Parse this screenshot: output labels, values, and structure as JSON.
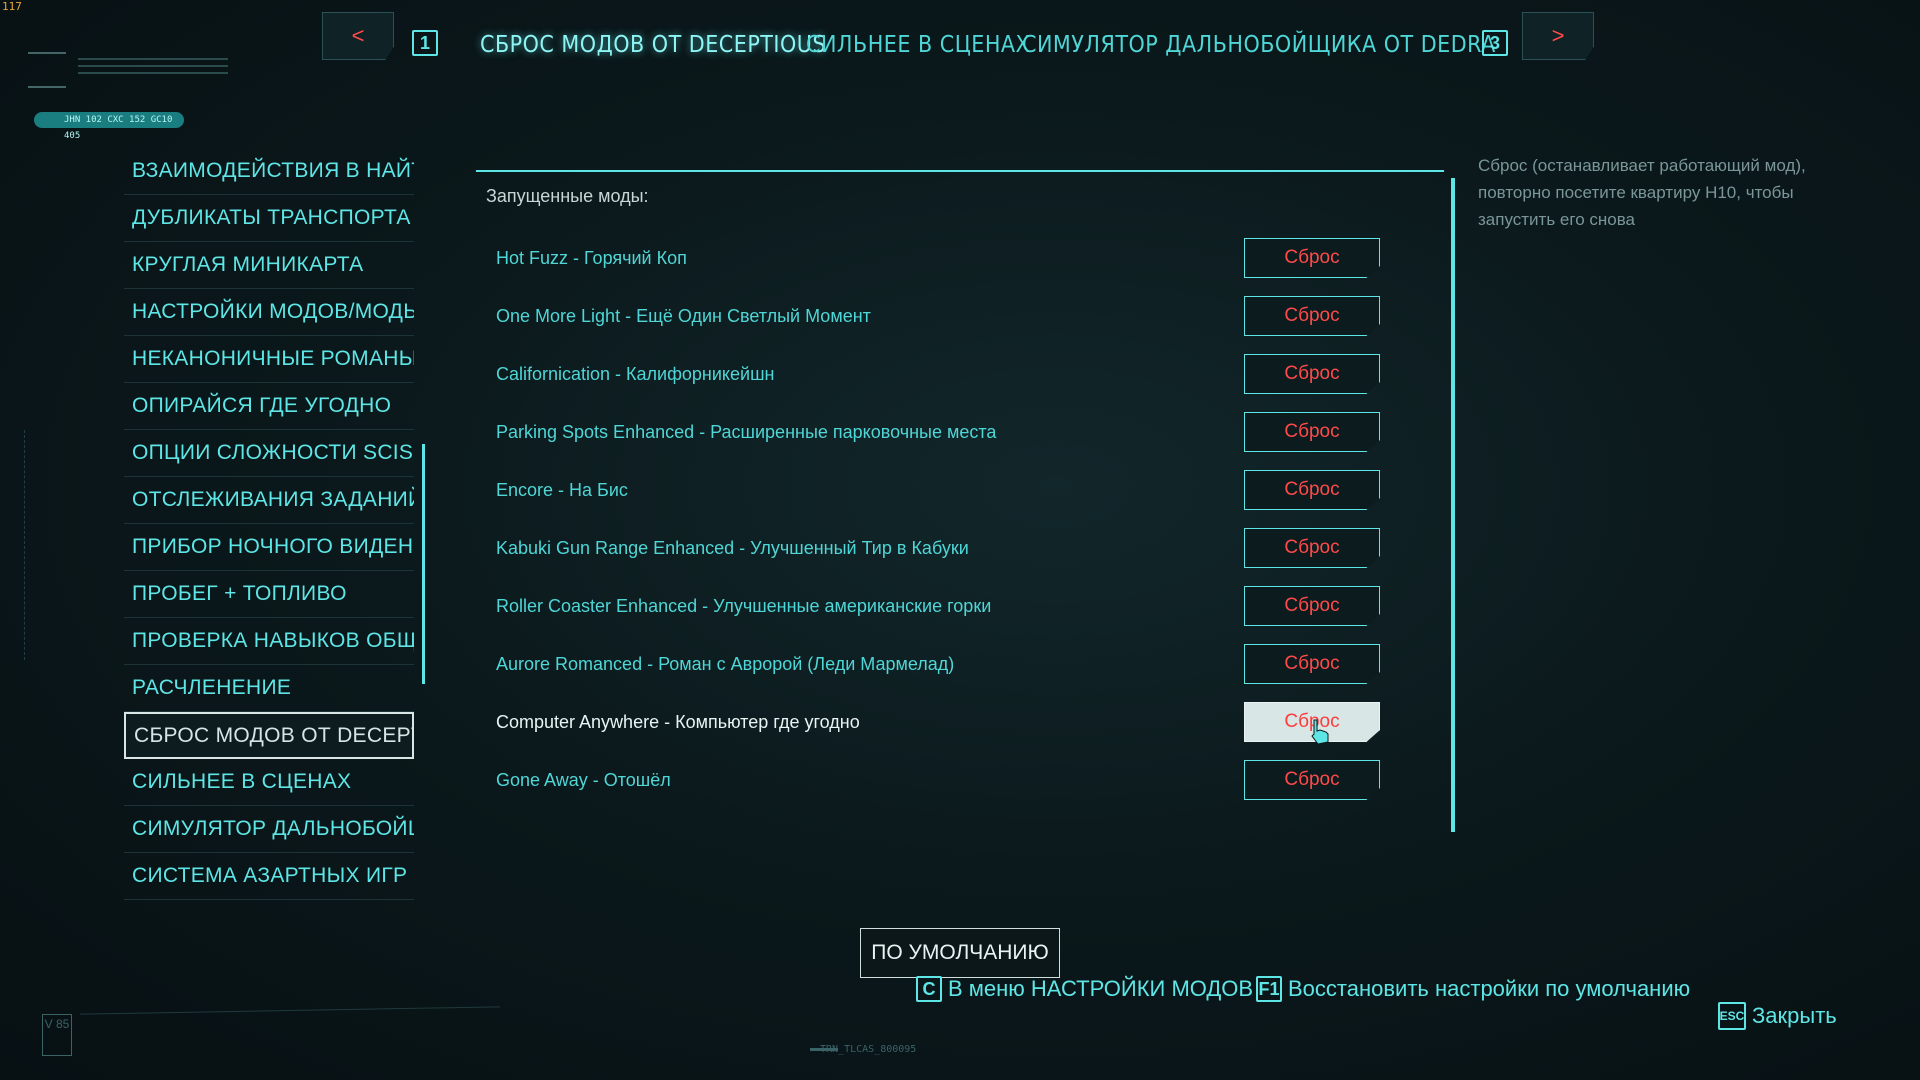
{
  "corner_counter": "117",
  "tag_bar_text": "JHN 102 CXC 152 GC10 405",
  "top_nav": {
    "prev_symbol": "<",
    "next_symbol": ">",
    "prev_key": "1",
    "next_key": "3",
    "tabs": [
      {
        "label": "СБРОС МОДОВ ОТ DECEPTIOUS",
        "active": true
      },
      {
        "label": "СИЛЬНЕЕ В СЦЕНАХ",
        "active": false
      },
      {
        "label": "СИМУЛЯТОР ДАЛЬНОБОЙЩИКА ОТ DEDRA",
        "active": false
      }
    ]
  },
  "sidebar": {
    "items": [
      {
        "label": "ВЗАИМОДЕЙСТВИЯ В НАЙТ СИ"
      },
      {
        "label": "ДУБЛИКАТЫ ТРАНСПОРТА"
      },
      {
        "label": "КРУГЛАЯ МИНИКАРТА"
      },
      {
        "label": "НАСТРОЙКИ МОДОВ/МОДЫ"
      },
      {
        "label": "НЕКАНОНИЧНЫЕ РОМАНЫ"
      },
      {
        "label": "ОПИРАЙСЯ ГДЕ УГОДНО"
      },
      {
        "label": "ОПЦИИ СЛОЖНОСТИ SCISSOF"
      },
      {
        "label": "ОТСЛЕЖИВАНИЯ ЗАДАНИЙ"
      },
      {
        "label": "ПРИБОР НОЧНОГО ВИДЕНИЯ"
      },
      {
        "label": "ПРОБЕГ + ТОПЛИВО"
      },
      {
        "label": "ПРОВЕРКА НАВЫКОВ ОБЩЕНИ"
      },
      {
        "label": "РАСЧЛЕНЕНИЕ"
      },
      {
        "label": "СБРОС МОДОВ ОТ DECEPTIOU"
      },
      {
        "label": "СИЛЬНЕЕ В СЦЕНАХ"
      },
      {
        "label": "СИМУЛЯТОР ДАЛЬНОБОЙЩИ"
      },
      {
        "label": "СИСТЕМА АЗАРТНЫХ ИГР"
      }
    ],
    "active_index": 12
  },
  "panel": {
    "title": "Запущенные моды:",
    "reset_label": "Сброс",
    "mods": [
      {
        "name": "Hot Fuzz - Горячий Коп"
      },
      {
        "name": "One More Light - Ещё Один Светлый Момент"
      },
      {
        "name": "Californication - Калифорникейшн"
      },
      {
        "name": "Parking Spots Enhanced - Расширенные парковочные места"
      },
      {
        "name": "Encore - На Бис"
      },
      {
        "name": "Kabuki Gun Range Enhanced - Улучшенный Тир в Кабуки"
      },
      {
        "name": "Roller Coaster Enhanced - Улучшенные американские горки"
      },
      {
        "name": "Aurore Romanced - Роман с Авророй (Леди Мармелад)"
      },
      {
        "name": "Computer Anywhere - Компьютер где угодно"
      },
      {
        "name": "Gone Away - Отошёл"
      }
    ],
    "hovered_index": 8
  },
  "hint": {
    "text": "Сброс (останавливает работающий мод), повторно посетите квартиру H10, чтобы запустить его снова"
  },
  "bottom": {
    "default_button": "ПО УМОЛЧАНИЮ",
    "hotkeys": [
      {
        "key": "C",
        "label": "В меню НАСТРОЙКИ МОДОВ"
      },
      {
        "key": "F1",
        "label": "Восстановить настройки по умолчанию"
      },
      {
        "key": "ESC",
        "label": "Закрыть"
      }
    ],
    "version_badge": "V 85",
    "code": "TRN_TLCAS_800095"
  },
  "colors": {
    "accent": "#5ee6e6",
    "danger": "#ff4a4a",
    "background": "#0b191c"
  }
}
